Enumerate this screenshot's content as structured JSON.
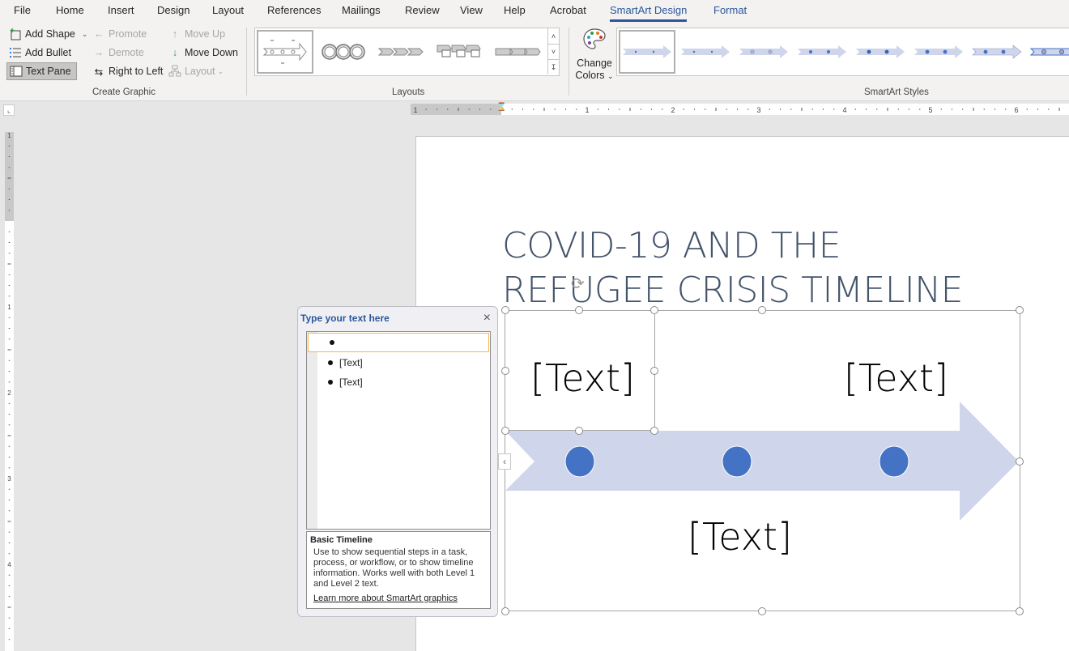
{
  "menu_tabs": [
    {
      "label": "File"
    },
    {
      "label": "Home"
    },
    {
      "label": "Insert"
    },
    {
      "label": "Design"
    },
    {
      "label": "Layout"
    },
    {
      "label": "References"
    },
    {
      "label": "Mailings"
    },
    {
      "label": "Review"
    },
    {
      "label": "View"
    },
    {
      "label": "Help"
    },
    {
      "label": "Acrobat"
    },
    {
      "label": "SmartArt Design",
      "active": true
    },
    {
      "label": "Format"
    }
  ],
  "ribbon": {
    "create_graphic": {
      "label": "Create Graphic",
      "add_shape": "Add Shape",
      "add_bullet": "Add Bullet",
      "text_pane": "Text Pane",
      "promote": "Promote",
      "demote": "Demote",
      "right_to_left": "Right to Left",
      "move_up": "Move Up",
      "move_down": "Move Down",
      "layout": "Layout"
    },
    "layouts": {
      "label": "Layouts",
      "items": [
        "Basic Timeline",
        "Circle Accent Timeline",
        "Basic Chevron Process",
        "Accent Process",
        "Closed Chevron Process"
      ],
      "selected": 0
    },
    "change_colors": {
      "line1": "Change",
      "line2": "Colors"
    },
    "smartart_styles": {
      "label": "SmartArt Styles",
      "items": [
        "Simple Fill",
        "White Outline",
        "Subtle Effect",
        "Moderate Effect",
        "Intense Effect",
        "Polished",
        "Inset",
        "Cartoon"
      ],
      "selected": 0
    }
  },
  "rulers": {
    "horizontal_labels": [
      "1",
      "1",
      "2",
      "3",
      "4",
      "5",
      "6"
    ],
    "vertical_labels": [
      "1",
      "1",
      "2",
      "3",
      "4"
    ]
  },
  "document": {
    "title": "COVID-19 AND THE\nREFUGEE CRISIS TIMELINE",
    "title_color": "#44546a"
  },
  "smartart": {
    "arrow_color": "#cfd5ea",
    "dot_color": "#4472c4",
    "texts": [
      "[Text]",
      "[Text]",
      "[Text]"
    ]
  },
  "text_pane": {
    "title": "Type your text here",
    "close": "×",
    "items": [
      "",
      "[Text]",
      "[Text]"
    ],
    "description_title": "Basic Timeline",
    "description": "Use to show sequential steps in a task, process, or workflow, or to show timeline information. Works well with both Level 1 and Level 2 text.",
    "link": "Learn more about SmartArt graphics"
  }
}
